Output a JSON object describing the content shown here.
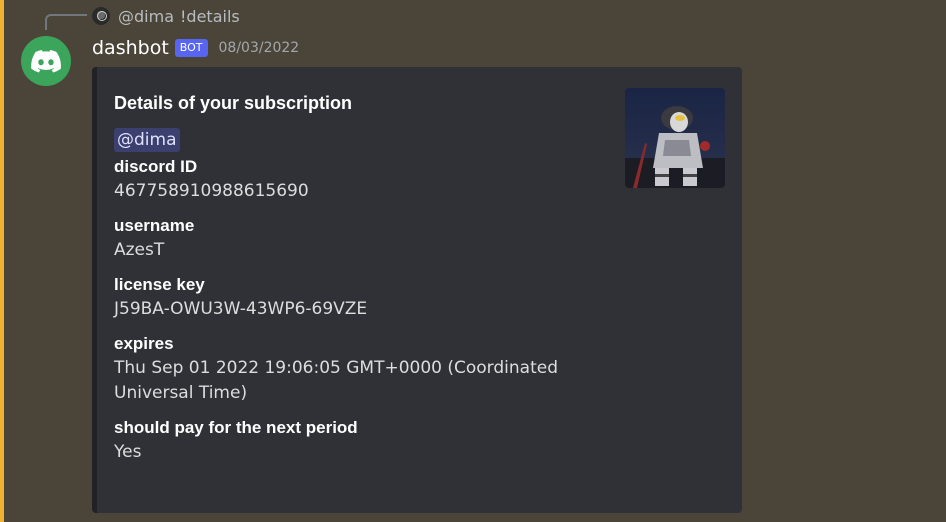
{
  "reply": {
    "mention": "@dima",
    "text": "!details"
  },
  "message": {
    "author": "dashbot",
    "bot_tag": "BOT",
    "timestamp": "08/03/2022"
  },
  "embed": {
    "title": "Details of your subscription",
    "mention": "@dima",
    "fields": [
      {
        "name": "discord ID",
        "value": "467758910988615690"
      },
      {
        "name": "username",
        "value": "AzesT"
      },
      {
        "name": "license key",
        "value": "J59BA-OWU3W-43WP6-69VZE"
      },
      {
        "name": "expires",
        "value": "Thu Sep 01 2022 19:06:05 GMT+0000 (Coordinated Universal Time)"
      },
      {
        "name": "should pay for the next period",
        "value": "Yes"
      }
    ]
  },
  "icons": {
    "avatar": "discord-logo-icon",
    "reply_avatar": "user-avatar",
    "thumbnail": "character-thumbnail"
  },
  "colors": {
    "background": "#4b4539",
    "accent": "#f0b232",
    "avatar_bg": "#3ba55c",
    "bot_tag": "#5865f2",
    "embed_bg": "#2f3136"
  }
}
